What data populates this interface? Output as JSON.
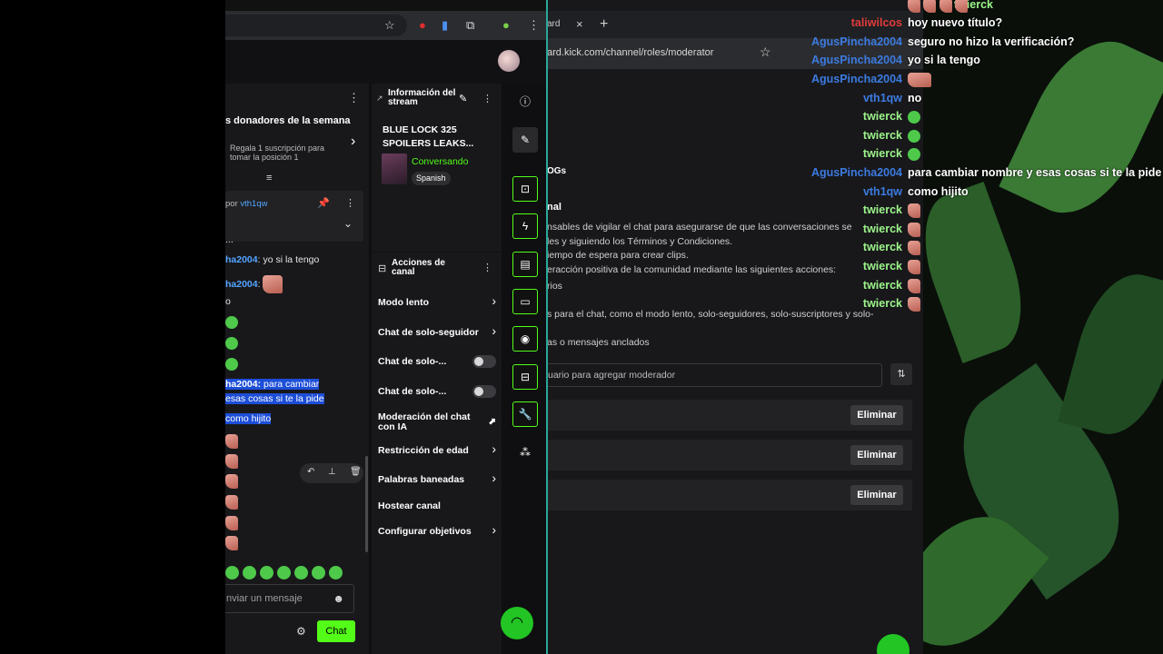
{
  "background_window": {
    "tab_title": "ard",
    "tab_close": "×",
    "new_tab": "+",
    "url": "ard.kick.com/channel/roles/moderator",
    "headings": [
      "OGs",
      "nal"
    ],
    "description_lines": [
      "nsables de vigilar el chat para asegurarse de que las conversaciones se",
      "les y siguiendo los Términos y Condiciones.",
      "iempo de espera para crear clips.",
      "eracción positiva de la comunidad mediante las siguientes acciones:",
      "rios",
      "s para el chat, como el modo lento, solo-seguidores, solo-suscriptores y solo-",
      "as o mensajes anclados"
    ],
    "search_placeholder": "uario para agregar moderador",
    "sort_icon": "sort-icon",
    "delete_label": "Eliminar"
  },
  "overlay_chat": [
    {
      "user": "twierck",
      "color": "#9cf58a",
      "message": ""
    },
    {
      "user": "taliwilcos",
      "color": "#e03c3c",
      "message": "hoy nuevo título?"
    },
    {
      "user": "AgusPincha2004",
      "color": "#3c7be0",
      "message": "seguro no hizo la verificación?"
    },
    {
      "user": "AgusPincha2004",
      "color": "#3c7be0",
      "message": "yo si la tengo"
    },
    {
      "user": "AgusPincha2004",
      "color": "#3c7be0",
      "message": ""
    },
    {
      "user": "vth1qw",
      "color": "#3c7be0",
      "message": "no"
    },
    {
      "user": "twierck",
      "color": "#9cf58a",
      "message": ""
    },
    {
      "user": "twierck",
      "color": "#9cf58a",
      "message": ""
    },
    {
      "user": "twierck",
      "color": "#9cf58a",
      "message": ""
    },
    {
      "user": "AgusPincha2004",
      "color": "#3c7be0",
      "message": "para cambiar nombre y esas cosas si te la pide"
    },
    {
      "user": "vth1qw",
      "color": "#3c7be0",
      "message": "como hijito"
    },
    {
      "user": "twierck",
      "color": "#9cf58a",
      "message": ""
    },
    {
      "user": "twierck",
      "color": "#9cf58a",
      "message": ""
    },
    {
      "user": "twierck",
      "color": "#9cf58a",
      "message": ""
    },
    {
      "user": "twierck",
      "color": "#9cf58a",
      "message": ""
    },
    {
      "user": "twierck",
      "color": "#9cf58a",
      "message": ""
    },
    {
      "user": "twierck",
      "color": "#9cf58a",
      "message": ""
    }
  ],
  "chat": {
    "donors_title": "s donadores de la semana",
    "donors_sub": "Regala 1 suscripción para tomar la posición 1",
    "pinned_prefix": "por",
    "pinned_user": "vth1qw",
    "ellipsis": "...",
    "messages": [
      {
        "user": "ha2004",
        "text": "yo si la tengo"
      },
      {
        "user": "ha2004",
        "text": ""
      },
      {
        "user": "",
        "text": "o"
      }
    ],
    "highlight_user": "ha2004:",
    "highlight_text_1": "para cambiar",
    "highlight_text_2": "esas cosas si te la pide",
    "highlight_text_3": "como hijito",
    "input_placeholder": "nviar un mensaje",
    "send_label": "Chat"
  },
  "stream_info": {
    "title": "Información del stream",
    "stream_title": "BLUE LOCK 325 SPOILERS LEAKS...",
    "category": "Conversando",
    "language": "Spanish"
  },
  "actions": {
    "title": "Acciones de canal",
    "items": [
      {
        "label": "Modo lento",
        "control": "arrow"
      },
      {
        "label": "Chat de solo-seguidor",
        "control": "arrow"
      },
      {
        "label": "Chat de solo-...",
        "control": "toggle"
      },
      {
        "label": "Chat de solo-...",
        "control": "toggle"
      },
      {
        "label": "Moderación del chat con IA",
        "control": "external"
      },
      {
        "label": "Restricción de edad",
        "control": "arrow"
      },
      {
        "label": "Palabras baneadas",
        "control": "arrow"
      },
      {
        "label": "Hostear canal",
        "control": "none"
      },
      {
        "label": "Configurar objetivos",
        "control": "arrow"
      }
    ]
  },
  "colors": {
    "kick_green": "#53fc18",
    "link_blue": "#53a5ff",
    "panel": "#18181b"
  }
}
